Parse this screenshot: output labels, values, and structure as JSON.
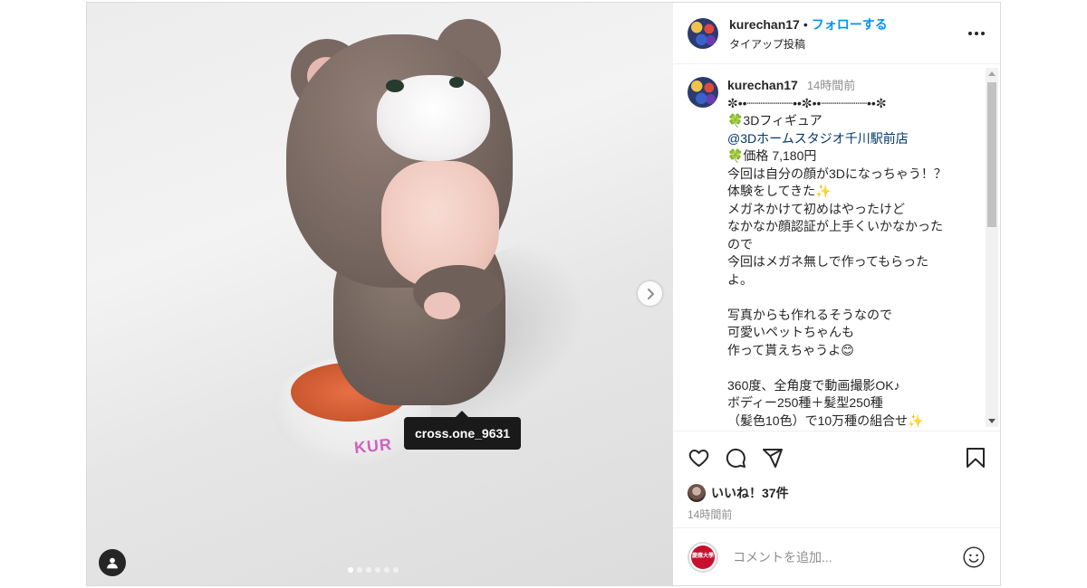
{
  "post": {
    "username": "kurechan17",
    "separator": "•",
    "follow_label": "フォローする",
    "subtitle": "タイアップ投稿",
    "more_icon": "more-horizontal-icon"
  },
  "media": {
    "tag_tooltip": "cross.one_9631",
    "base_text": "KUR",
    "dots_total": 6,
    "active_dot": 0,
    "next_icon": "chevron-right-icon",
    "user_tag_icon": "user-icon"
  },
  "caption": {
    "username": "kurechan17",
    "time": "14時間前",
    "lines": [
      "✼••┈┈┈┈┈┈••✼••┈┈┈┈┈┈••✼",
      "🍀3Dフィギュア",
      "@3Dホームスタジオ千川駅前店",
      "🍀価格 7,180円",
      "今回は自分の顔が3Dになっちゃう！？",
      "体験をしてきた✨",
      "メガネかけて初めはやったけど",
      "なかなか顔認証が上手くいかなかった",
      "ので",
      "今回はメガネ無しで作ってもらった",
      "よ。",
      "",
      "写真からも作れるそうなので",
      "可愛いペットちゃんも",
      "作って貰えちゃうよ😊",
      "",
      "360度、全角度で動画撮影OK♪",
      "ボディー250種＋髪型250種",
      "（髪色10色）で10万種の組合せ✨"
    ]
  },
  "actions": {
    "like_icon": "heart-icon",
    "comment_icon": "comment-icon",
    "share_icon": "send-icon",
    "save_icon": "bookmark-icon"
  },
  "likes": {
    "text": "いいね！37件"
  },
  "posted_time": "14時間前",
  "comment": {
    "placeholder": "コメントを追加...",
    "avatar_text": "慶應大學",
    "emoji_icon": "smiley-icon"
  }
}
